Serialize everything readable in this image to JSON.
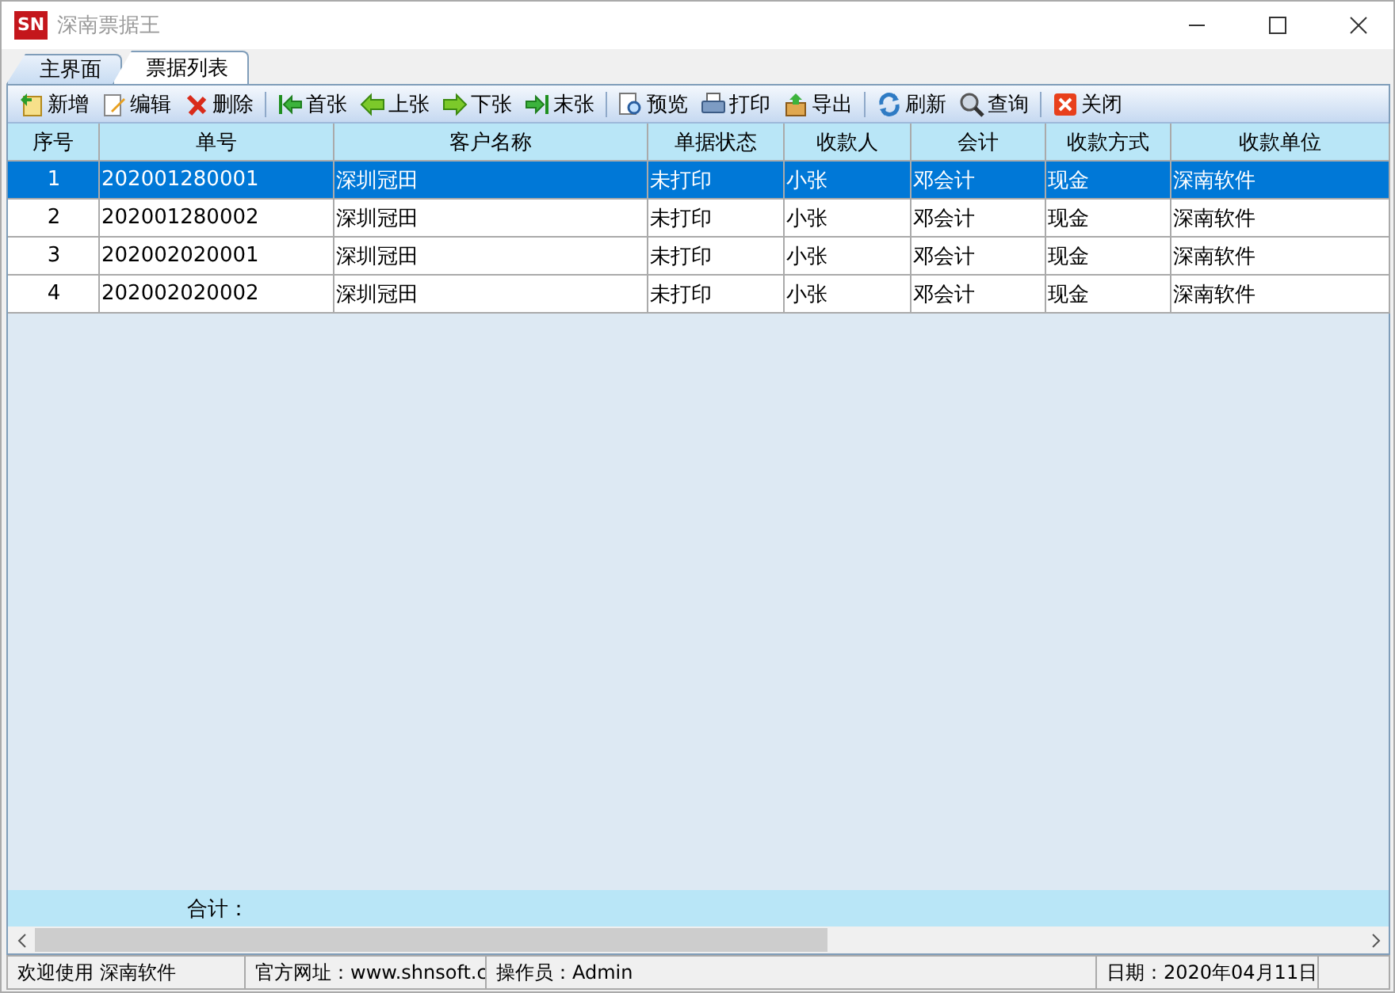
{
  "window": {
    "logo": "SN",
    "title": "深南票据王"
  },
  "tabs": [
    {
      "label": "主界面",
      "selected": false
    },
    {
      "label": "票据列表",
      "selected": true
    }
  ],
  "toolbar": [
    {
      "kind": "new",
      "label": "新增"
    },
    {
      "kind": "edit",
      "label": "编辑"
    },
    {
      "kind": "delete",
      "label": "删除"
    },
    {
      "kind": "sep"
    },
    {
      "kind": "first",
      "label": "首张"
    },
    {
      "kind": "prev",
      "label": "上张"
    },
    {
      "kind": "next",
      "label": "下张"
    },
    {
      "kind": "last",
      "label": "末张"
    },
    {
      "kind": "sep"
    },
    {
      "kind": "preview",
      "label": "预览"
    },
    {
      "kind": "print",
      "label": "打印"
    },
    {
      "kind": "export",
      "label": "导出"
    },
    {
      "kind": "sep"
    },
    {
      "kind": "refresh",
      "label": "刷新"
    },
    {
      "kind": "query",
      "label": "查询"
    },
    {
      "kind": "sep"
    },
    {
      "kind": "close",
      "label": "关闭"
    }
  ],
  "table": {
    "columns": [
      "序号",
      "单号",
      "客户名称",
      "单据状态",
      "收款人",
      "会计",
      "收款方式",
      "收款单位"
    ],
    "rows": [
      {
        "selected": true,
        "cells": [
          "1",
          "202001280001",
          "深圳冠田",
          "未打印",
          "小张",
          "邓会计",
          "现金",
          "深南软件"
        ]
      },
      {
        "selected": false,
        "cells": [
          "2",
          "202001280002",
          "深圳冠田",
          "未打印",
          "小张",
          "邓会计",
          "现金",
          "深南软件"
        ]
      },
      {
        "selected": false,
        "cells": [
          "3",
          "202002020001",
          "深圳冠田",
          "未打印",
          "小张",
          "邓会计",
          "现金",
          "深南软件"
        ]
      },
      {
        "selected": false,
        "cells": [
          "4",
          "202002020002",
          "深圳冠田",
          "未打印",
          "小张",
          "邓会计",
          "现金",
          "深南软件"
        ]
      }
    ],
    "total_label": "合计："
  },
  "status_bar": [
    "欢迎使用 深南软件",
    "官方网址：www.shnsoft.c",
    "操作员：Admin",
    "日期：2020年04月11日"
  ]
}
